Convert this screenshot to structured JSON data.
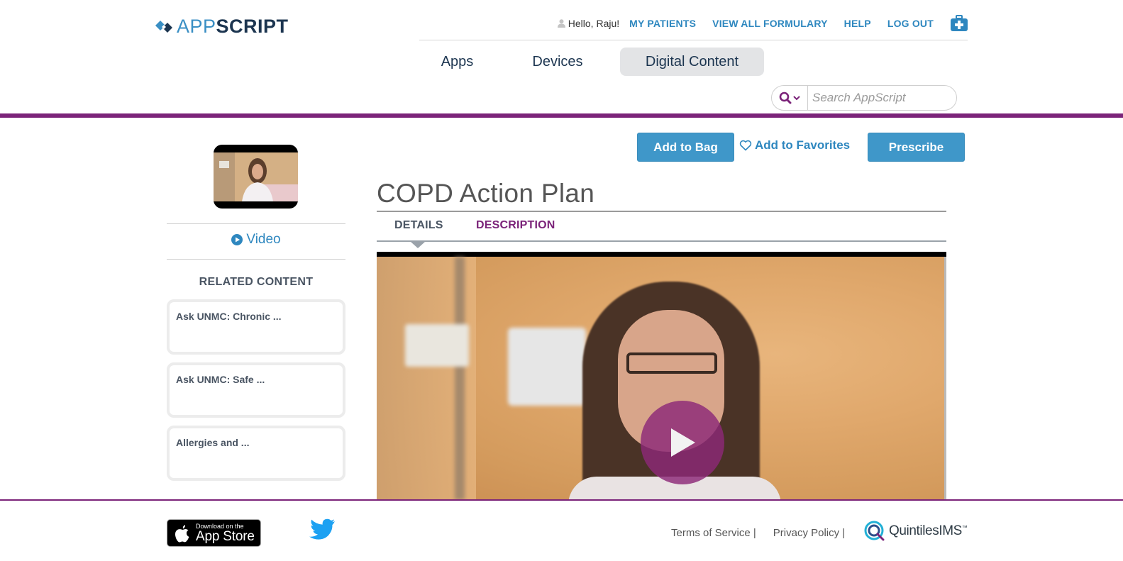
{
  "brand": {
    "app": "APP",
    "script": "SCRIPT"
  },
  "util_nav": {
    "greeting": "Hello, Raju!",
    "links": [
      "MY PATIENTS",
      "VIEW ALL FORMULARY",
      "HELP",
      "LOG OUT"
    ]
  },
  "main_nav": {
    "tabs": [
      "Apps",
      "Devices",
      "Digital Content"
    ],
    "active": "Digital Content"
  },
  "search": {
    "placeholder": "Search AppScript"
  },
  "sidebar": {
    "media_label": "Video",
    "related_title": "RELATED CONTENT",
    "related": [
      "Ask UNMC: Chronic ...",
      "Ask UNMC: Safe ...",
      "Allergies and ..."
    ]
  },
  "actions": {
    "add_to_bag": "Add to Bag",
    "add_to_favorites": "Add to Favorites",
    "prescribe": "Prescribe"
  },
  "content": {
    "title": "COPD Action Plan",
    "tabs": [
      "DETAILS",
      "DESCRIPTION"
    ],
    "active_tab": "DETAILS"
  },
  "footer": {
    "appstore_small": "Download on the",
    "appstore_big": "App Store",
    "links": [
      "Terms of Service |",
      "Privacy Policy |"
    ],
    "partner": "QuintilesIMS",
    "partner_mark": "™"
  },
  "colors": {
    "brand_purple": "#7b2379",
    "link_blue": "#2e87bf",
    "button_blue": "#3f97c9",
    "navy": "#1c3550"
  }
}
